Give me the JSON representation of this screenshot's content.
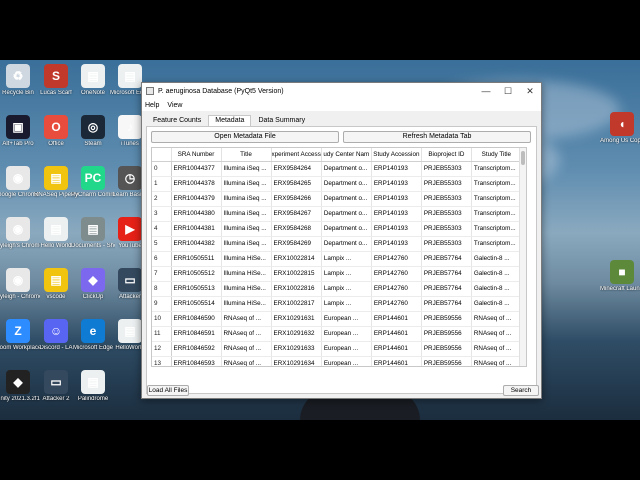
{
  "desktop": {
    "icons_left": [
      {
        "label": "Recycle Bin",
        "color": "#cfd8e0",
        "glyph": "♻"
      },
      {
        "label": "Alt+Tab Pro",
        "color": "#1a1a2e",
        "glyph": "▣"
      },
      {
        "label": "Google Chrome",
        "color": "#e8e8e8",
        "glyph": "◉"
      },
      {
        "label": "Kyleigh's Chrome",
        "color": "#e8e8e8",
        "glyph": "◉"
      },
      {
        "label": "Kyleigh - Chrome",
        "color": "#e8e8e8",
        "glyph": "◉"
      },
      {
        "label": "Zoom Workplace",
        "color": "#2d8cff",
        "glyph": "Z"
      },
      {
        "label": "Unity 2021.3.2f1",
        "color": "#222",
        "glyph": "◆"
      }
    ],
    "icons_col2": [
      {
        "label": "Lucas Scarf",
        "color": "#c0392b",
        "glyph": "S"
      },
      {
        "label": "Office",
        "color": "#e74c3c",
        "glyph": "O"
      },
      {
        "label": "RNASeq Pipeline",
        "color": "#f1c40f",
        "glyph": "▤"
      },
      {
        "label": "Hello World",
        "color": "#ecf0f1",
        "glyph": "▤"
      },
      {
        "label": "vscode",
        "color": "#f1c40f",
        "glyph": "▤"
      },
      {
        "label": "Discord - LA",
        "color": "#5865f2",
        "glyph": "☺"
      },
      {
        "label": "Attacker 2",
        "color": "#34495e",
        "glyph": "▭"
      }
    ],
    "icons_col3": [
      {
        "label": "OneNote",
        "color": "#ecf0f1",
        "glyph": "▤"
      },
      {
        "label": "Steam",
        "color": "#1b2838",
        "glyph": "◎"
      },
      {
        "label": "PyCharm Community",
        "color": "#21d789",
        "glyph": "PC"
      },
      {
        "label": "Documents - Shortcut",
        "color": "#7f8c8d",
        "glyph": "▤"
      },
      {
        "label": "ClickUp",
        "color": "#7b68ee",
        "glyph": "◆"
      },
      {
        "label": "Microsoft Edge",
        "color": "#0f7bd3",
        "glyph": "e"
      },
      {
        "label": "Palindrome",
        "color": "#ecf0f1",
        "glyph": "▤"
      }
    ],
    "icons_col4": [
      {
        "label": "Microsoft Edge",
        "color": "#ecf0f1",
        "glyph": "▤"
      },
      {
        "label": "iTunes",
        "color": "#f7f7f7",
        "glyph": "♪"
      },
      {
        "label": "Learn Basics",
        "color": "#555",
        "glyph": "◷"
      },
      {
        "label": "YouTube",
        "color": "#e62117",
        "glyph": "▶"
      },
      {
        "label": "Attacker",
        "color": "#34495e",
        "glyph": "▭"
      },
      {
        "label": "HelloWorld",
        "color": "#ecf0f1",
        "glyph": "▤"
      }
    ],
    "icons_right": [
      {
        "label": "Among Us Copy",
        "color": "#c0392b",
        "glyph": "◖"
      },
      {
        "label": "Minecraft Launcher",
        "color": "#5d8a3a",
        "glyph": "■"
      }
    ]
  },
  "window": {
    "title": "P. aeruginosa Database (PyQt5 Version)",
    "controls": {
      "minimize": "—",
      "maximize": "☐",
      "close": "✕"
    },
    "menu": [
      "Help",
      "View"
    ],
    "tabs": [
      "Feature Counts",
      "Metadata",
      "Data Summary"
    ],
    "active_tab": "Metadata",
    "buttons": {
      "open": "Open Metadata File",
      "refresh": "Refresh Metadata Tab",
      "load_all": "Load All Files",
      "search": "Search"
    },
    "table": {
      "columns": [
        "SRA Number",
        "Title",
        "xperiment Access",
        "udy Center Nam",
        "Study Accession",
        "Bioproject ID",
        "Study Title"
      ],
      "rows": [
        [
          "0",
          "ERR10044377",
          "Illumina iSeq ...",
          "ERX9584264",
          "Department o...",
          "ERP140193",
          "PRJEB55303",
          "Transcriptom..."
        ],
        [
          "1",
          "ERR10044378",
          "Illumina iSeq ...",
          "ERX9584265",
          "Department o...",
          "ERP140193",
          "PRJEB55303",
          "Transcriptom..."
        ],
        [
          "2",
          "ERR10044379",
          "Illumina iSeq ...",
          "ERX9584266",
          "Department o...",
          "ERP140193",
          "PRJEB55303",
          "Transcriptom..."
        ],
        [
          "3",
          "ERR10044380",
          "Illumina iSeq ...",
          "ERX9584267",
          "Department o...",
          "ERP140193",
          "PRJEB55303",
          "Transcriptom..."
        ],
        [
          "4",
          "ERR10044381",
          "Illumina iSeq ...",
          "ERX9584268",
          "Department o...",
          "ERP140193",
          "PRJEB55303",
          "Transcriptom..."
        ],
        [
          "5",
          "ERR10044382",
          "Illumina iSeq ...",
          "ERX9584269",
          "Department o...",
          "ERP140193",
          "PRJEB55303",
          "Transcriptom..."
        ],
        [
          "6",
          "ERR10505511",
          "Illumina HiSe...",
          "ERX10022814",
          "Lampix ...",
          "ERP142760",
          "PRJEB57764",
          "Galectin-8 ..."
        ],
        [
          "7",
          "ERR10505512",
          "Illumina HiSe...",
          "ERX10022815",
          "Lampix ...",
          "ERP142760",
          "PRJEB57764",
          "Galectin-8 ..."
        ],
        [
          "8",
          "ERR10505513",
          "Illumina HiSe...",
          "ERX10022816",
          "Lampix ...",
          "ERP142760",
          "PRJEB57764",
          "Galectin-8 ..."
        ],
        [
          "9",
          "ERR10505514",
          "Illumina HiSe...",
          "ERX10022817",
          "Lampix ...",
          "ERP142760",
          "PRJEB57764",
          "Galectin-8 ..."
        ],
        [
          "10",
          "ERR10846590",
          "RNAseq of ...",
          "ERX10291631",
          "European ...",
          "ERP144601",
          "PRJEB59556",
          "RNAseq of ..."
        ],
        [
          "11",
          "ERR10846591",
          "RNAseq of ...",
          "ERX10291632",
          "European ...",
          "ERP144601",
          "PRJEB59556",
          "RNAseq of ..."
        ],
        [
          "12",
          "ERR10846592",
          "RNAseq of ...",
          "ERX10291633",
          "European ...",
          "ERP144601",
          "PRJEB59556",
          "RNAseq of ..."
        ],
        [
          "13",
          "ERR10846593",
          "RNAseq of ...",
          "ERX10291634",
          "European ...",
          "ERP144601",
          "PRJEB59556",
          "RNAseq of ..."
        ]
      ]
    }
  }
}
